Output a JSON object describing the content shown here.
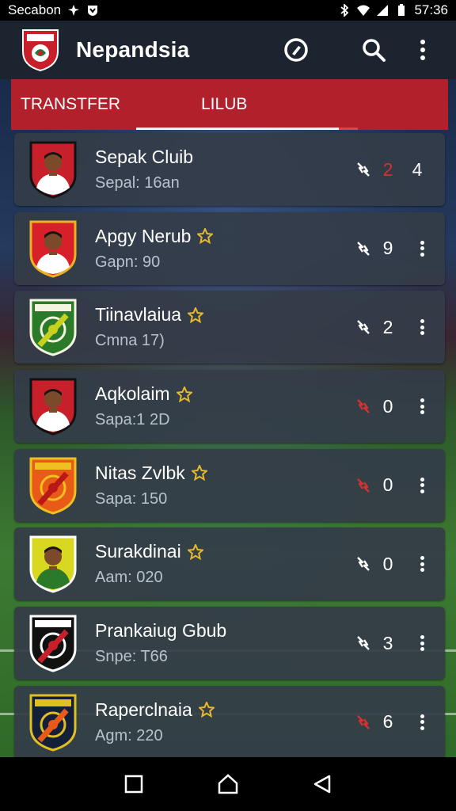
{
  "status_bar": {
    "carrier": "Secabon",
    "time": "57:36",
    "icons": [
      "bluetooth-icon",
      "shield-icon",
      "network-icon",
      "wifi-icon",
      "signal-icon",
      "battery-icon"
    ]
  },
  "app_bar": {
    "title": "Nepandsia",
    "logo_icon": "club-crest-icon",
    "actions": [
      "compass-icon",
      "search-icon",
      "more-vert-icon"
    ]
  },
  "tabs": [
    {
      "label": "TRANSTFER",
      "active": false
    },
    {
      "label": "LILUB",
      "active": true
    }
  ],
  "colors": {
    "accent_red": "#b2202c",
    "card_bg": "#343c48",
    "app_bar": "#1c2430",
    "star_gold": "#e6b92a",
    "swap_red": "#d83030"
  },
  "clubs": [
    {
      "name": "Sepak Cluib",
      "sub": "Sepal: 16an",
      "starred": false,
      "swap_red": false,
      "count": "2",
      "count_red": true,
      "extra": "4",
      "crest": {
        "type": "player",
        "c1": "#c8202a",
        "c2": "#ffffff",
        "c3": "#111111"
      }
    },
    {
      "name": "Apgy Nerub",
      "sub": "Gapn: 90",
      "starred": true,
      "swap_red": false,
      "count": "9",
      "count_red": false,
      "extra": "",
      "crest": {
        "type": "player",
        "c1": "#d8202a",
        "c2": "#ffffff",
        "c3": "#f0b020"
      }
    },
    {
      "name": "Tiinavlaiua",
      "sub": "Cmna 17)",
      "starred": true,
      "swap_red": false,
      "count": "2",
      "count_red": false,
      "extra": "",
      "crest": {
        "type": "badge",
        "c1": "#2a7a2a",
        "c2": "#f4f4e0",
        "c3": "#c8d020"
      }
    },
    {
      "name": "Aqkolaim",
      "sub": "Sapa:1 2D",
      "starred": true,
      "swap_red": true,
      "count": "0",
      "count_red": false,
      "extra": "",
      "crest": {
        "type": "player",
        "c1": "#c8202a",
        "c2": "#ffffff",
        "c3": "#111111"
      }
    },
    {
      "name": "Nitas Zvlbk",
      "sub": "Sapa: 150",
      "starred": true,
      "swap_red": true,
      "count": "0",
      "count_red": false,
      "extra": "",
      "crest": {
        "type": "badge",
        "c1": "#e85a18",
        "c2": "#f0c020",
        "c3": "#b81818"
      }
    },
    {
      "name": "Surakdinai",
      "sub": "Aam: 020",
      "starred": true,
      "swap_red": false,
      "count": "0",
      "count_red": false,
      "extra": "",
      "crest": {
        "type": "player",
        "c1": "#d8d820",
        "c2": "#2a7a2a",
        "c3": "#ffffff"
      }
    },
    {
      "name": "Prankaiug Gbub",
      "sub": "Snpe: T66",
      "starred": false,
      "swap_red": false,
      "count": "3",
      "count_red": false,
      "extra": "",
      "crest": {
        "type": "badge",
        "c1": "#111111",
        "c2": "#ffffff",
        "c3": "#c8202a"
      }
    },
    {
      "name": "Raperclnaia",
      "sub": "Agm: 220",
      "starred": true,
      "swap_red": true,
      "count": "6",
      "count_red": false,
      "extra": "",
      "crest": {
        "type": "badge",
        "c1": "#14203a",
        "c2": "#e0c020",
        "c3": "#e85a18"
      }
    }
  ],
  "nav_bar": {
    "buttons": [
      "recents-square-icon",
      "home-icon",
      "back-triangle-icon"
    ]
  }
}
